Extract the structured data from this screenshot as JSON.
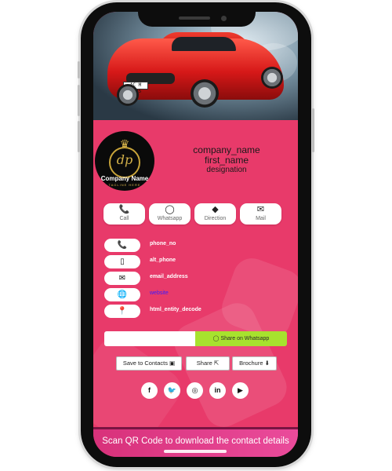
{
  "brand": {
    "logo_company": "Company Name",
    "logo_tagline": "TAGLINE HERE",
    "logo_monogram": "dp"
  },
  "hero": {
    "plate_text": "AC M 4005"
  },
  "profile": {
    "company": "company_name",
    "name": "first_name",
    "designation": "designation"
  },
  "actions": [
    {
      "label": "Call",
      "icon": "phone-icon",
      "glyph": "📞"
    },
    {
      "label": "Whatsapp",
      "icon": "whatsapp-icon",
      "glyph": "◯"
    },
    {
      "label": "Direction",
      "icon": "direction-icon",
      "glyph": "◆"
    },
    {
      "label": "Mail",
      "icon": "mail-icon",
      "glyph": "✉"
    }
  ],
  "info": [
    {
      "icon": "phone-icon",
      "glyph": "📞",
      "text": "phone_no"
    },
    {
      "icon": "mobile-icon",
      "glyph": "▯",
      "text": "alt_phone"
    },
    {
      "icon": "envelope-icon",
      "glyph": "✉",
      "text": "email_address"
    },
    {
      "icon": "globe-icon",
      "glyph": "🌐",
      "text": "website"
    },
    {
      "icon": "map-pin-icon",
      "glyph": "📍",
      "text": "html_entity_decode"
    }
  ],
  "share_whatsapp": {
    "input_value": "",
    "button_label": "Share on Whatsapp",
    "icon": "whatsapp-icon"
  },
  "buttons": {
    "save_contacts": "Save to Contacts",
    "share": "Share",
    "brochure": "Brochure"
  },
  "social": [
    {
      "icon": "facebook-icon",
      "glyph": "f"
    },
    {
      "icon": "twitter-icon",
      "glyph": "🐦"
    },
    {
      "icon": "instagram-icon",
      "glyph": "◎"
    },
    {
      "icon": "linkedin-icon",
      "glyph": "in"
    },
    {
      "icon": "youtube-icon",
      "glyph": "▶"
    }
  ],
  "footer": {
    "qr_text": "Scan QR Code to download the contact details"
  },
  "colors": {
    "card_background": "#e83a6a",
    "whatsapp_button": "#a7e22e",
    "logo_gold": "#d5b24a",
    "link_color": "#3a1cff"
  }
}
